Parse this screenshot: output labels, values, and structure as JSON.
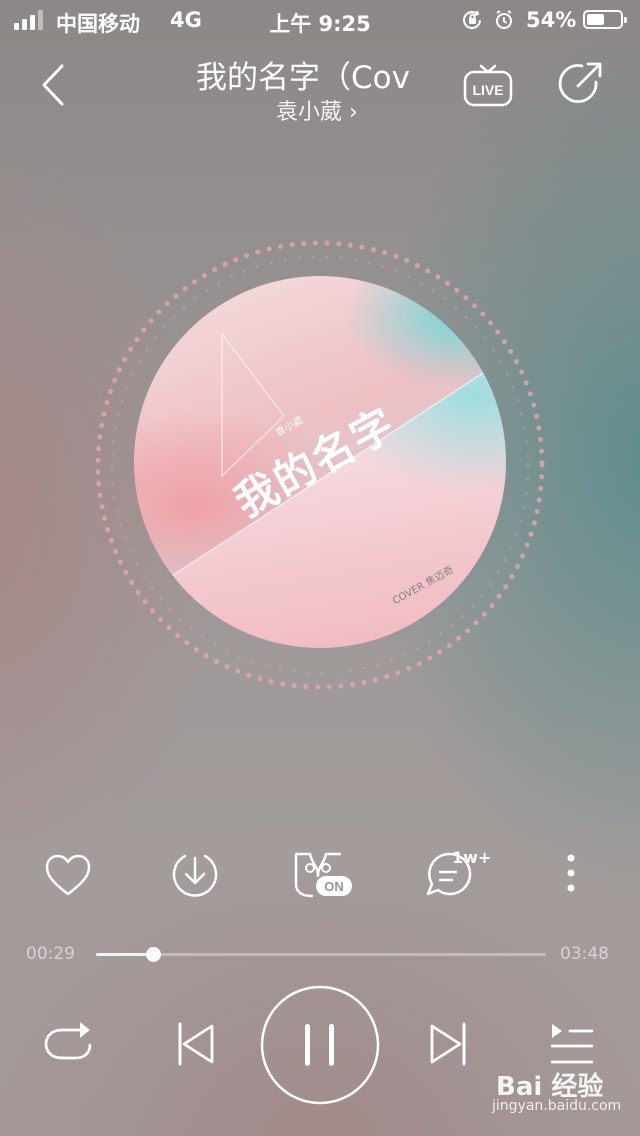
{
  "status_bar": {
    "carrier": "中国移动",
    "network": "4G",
    "time": "上午 9:25",
    "battery": "54%",
    "battery_level": 0.54
  },
  "header": {
    "title": "我的名字（Cov",
    "artist": "袁小葳 ›",
    "live_label": "LIVE"
  },
  "album_art": {
    "cover_title": "我的名字",
    "cover_artist": "袁小葳",
    "cover_credit": "COVER 焦迈奇"
  },
  "actions": {
    "comment_count": "1w+",
    "sound_effect_badge": "ON"
  },
  "progress": {
    "current_time": "00:29",
    "total_time": "03:48",
    "fraction": 0.127
  },
  "watermark": {
    "logo": "Bai  经验",
    "url": "jingyan.baidu.com"
  },
  "icons": [
    "back-icon",
    "live-icon",
    "share-icon",
    "heart-icon",
    "download-icon",
    "sound-effect-icon",
    "comment-icon",
    "more-icon",
    "repeat-icon",
    "previous-icon",
    "pause-icon",
    "next-icon",
    "playlist-icon"
  ]
}
